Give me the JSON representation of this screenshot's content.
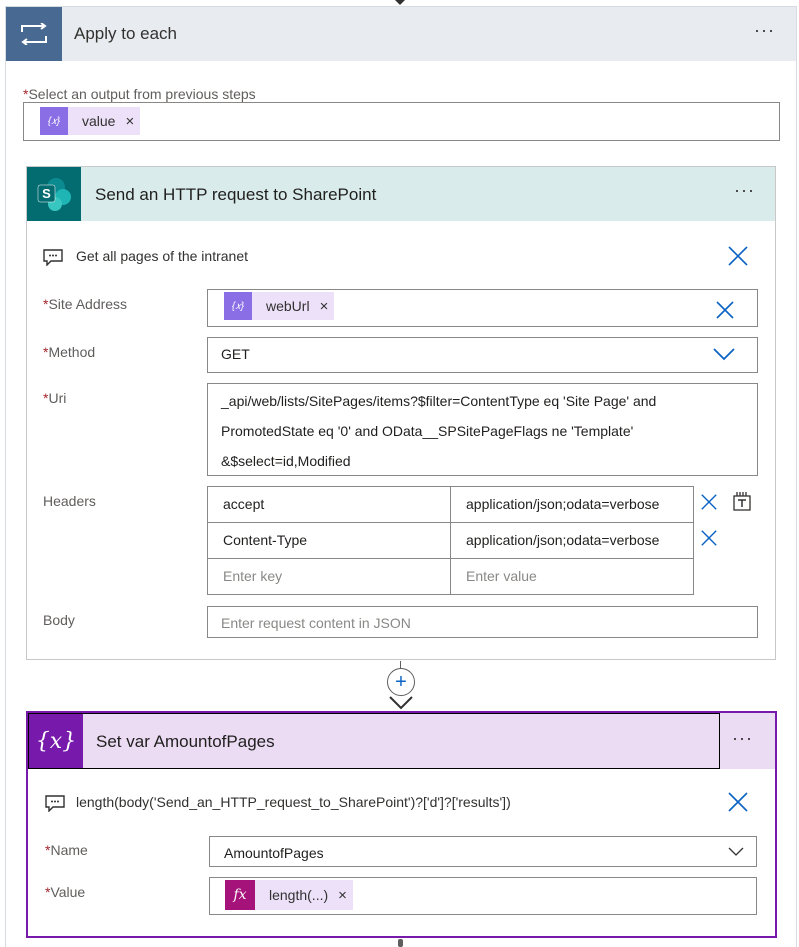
{
  "apply_each": {
    "title": "Apply to each",
    "menu": "···",
    "select_label": "Select an output from previous steps",
    "required_mark": "*",
    "select_token": "value",
    "token_remove": "×"
  },
  "sharepoint": {
    "title": "Send an HTTP request to SharePoint",
    "menu": "···",
    "comment": "Get all pages of the intranet",
    "site_address_label": "Site Address",
    "site_address_token": "webUrl",
    "method_label": "Method",
    "method_value": "GET",
    "uri_label": "Uri",
    "uri_lines": [
      "_api/web/lists/SitePages/items?$filter=ContentType eq 'Site Page' and",
      "PromotedState eq '0' and OData__SPSitePageFlags ne 'Template'",
      "&$select=id,Modified"
    ],
    "headers_label": "Headers",
    "headers": [
      {
        "key": "accept",
        "value": "application/json;odata=verbose"
      },
      {
        "key": "Content-Type",
        "value": "application/json;odata=verbose"
      }
    ],
    "header_key_placeholder": "Enter key",
    "header_value_placeholder": "Enter value",
    "body_label": "Body",
    "body_placeholder": "Enter request content in JSON"
  },
  "connector": {
    "add": "+"
  },
  "set_var": {
    "title": "Set var AmountofPages",
    "menu": "···",
    "icon_text": "{x}",
    "comment": "length(body('Send_an_HTTP_request_to_SharePoint')?['d']?['results'])",
    "name_label": "Name",
    "name_value": "AmountofPages",
    "value_label": "Value",
    "value_token": "length(...)",
    "fx_icon": "fx"
  },
  "colors": {
    "apply_header": "#e8ecf0",
    "apply_icon": "#486991",
    "sharepoint_header": "#d9eceb",
    "sharepoint_icon": "#036c70",
    "variable_header": "#ebdcf4",
    "variable_icon": "#7719aa",
    "dynamic_token": "#ece1f8",
    "dynamic_token_icon": "#8a6ee6",
    "expression_icon": "#a4127a",
    "action_blue": "#0b63c4"
  }
}
